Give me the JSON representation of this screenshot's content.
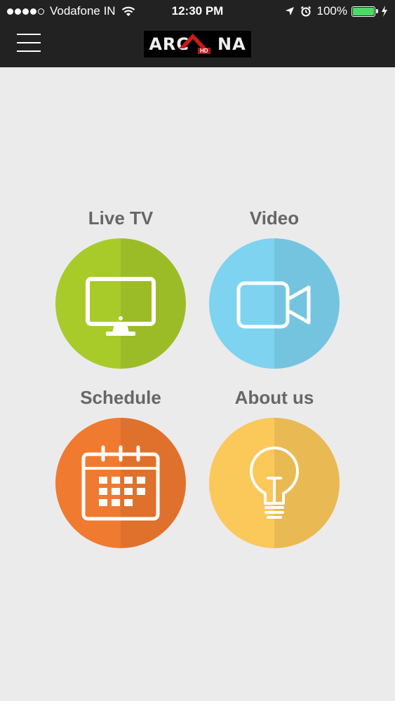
{
  "status_bar": {
    "carrier": "Vodafone IN",
    "time": "12:30 PM",
    "battery": "100%"
  },
  "header": {
    "logo_text_left": "ARC",
    "logo_text_right": "NA",
    "logo_sub": "HD"
  },
  "tiles": [
    {
      "label": "Live TV",
      "color": "#a8cb2a",
      "icon": "monitor-icon"
    },
    {
      "label": "Video",
      "color": "#7dd3f0",
      "icon": "video-camera-icon"
    },
    {
      "label": "Schedule",
      "color": "#f07a30",
      "icon": "calendar-icon"
    },
    {
      "label": "About us",
      "color": "#fbc85a",
      "icon": "lightbulb-icon"
    }
  ]
}
